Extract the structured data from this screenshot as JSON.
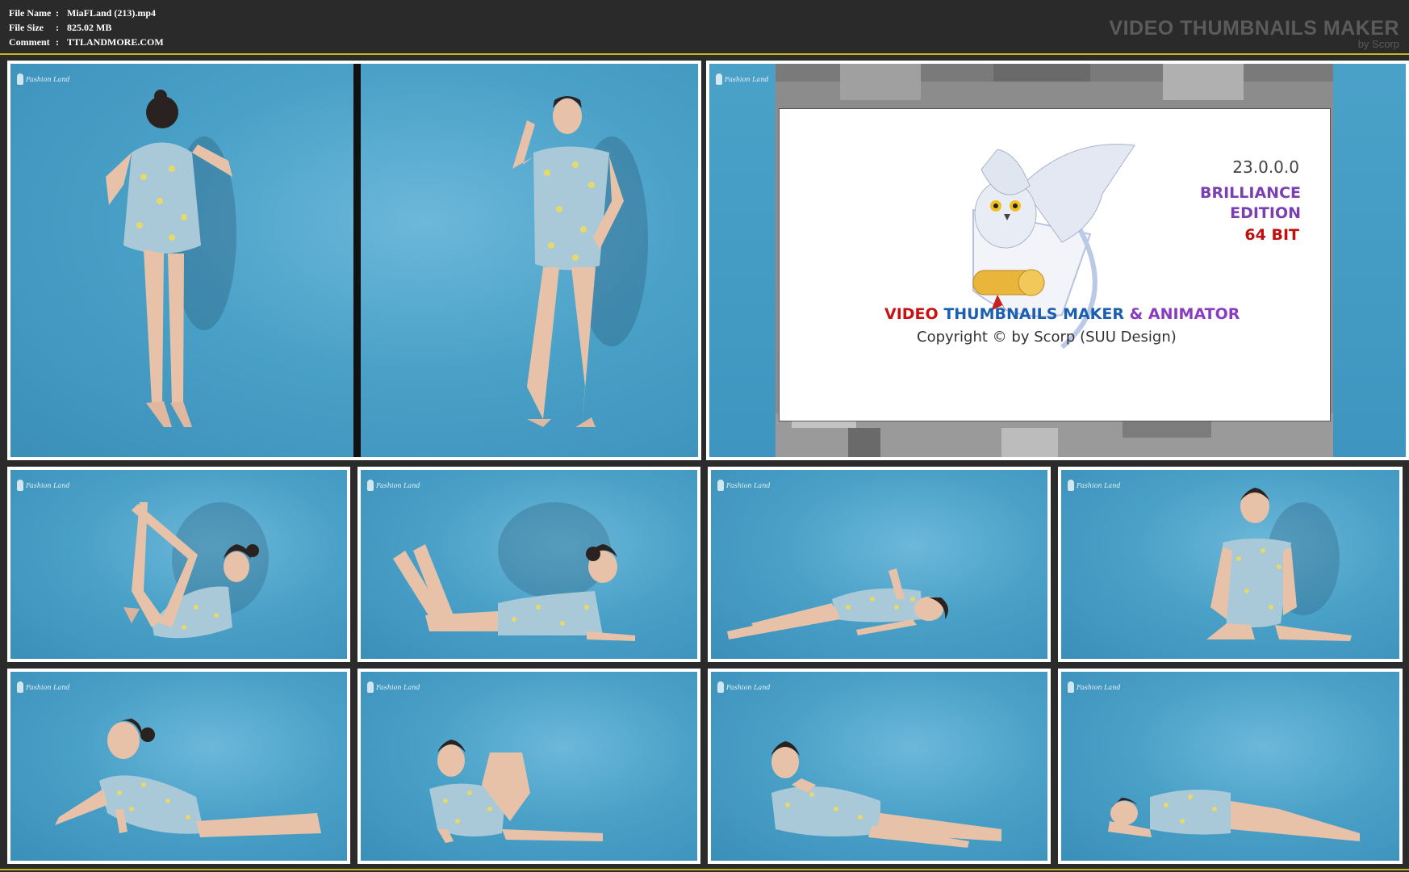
{
  "header": {
    "file_name_label": "File Name",
    "file_name_value": "MiaFLand (213).mp4",
    "file_size_label": "File Size",
    "file_size_value": "825.02 MB",
    "comment_label": "Comment",
    "comment_value": "TTLANDMORE.COM",
    "separator": ":",
    "brand_title": "VIDEO THUMBNAILS MAKER",
    "brand_sub": "by Scorp"
  },
  "watermark": "Fashion Land",
  "splash": {
    "version": "23.0.0.0",
    "edition_line1": "BRILLIANCE",
    "edition_line2": "EDITION",
    "bits": "64 BIT",
    "title_video": "VIDEO",
    "title_thumbnails": "THUMBNAILS MAKER",
    "title_amp": "&",
    "title_animator": "ANIMATOR",
    "copyright": "Copyright © by Scorp (SUU Design)"
  },
  "colors": {
    "background": "#2b2b2b",
    "accent_line": "#c7b521",
    "backdrop_blue": "#4aa1c8",
    "frame": "#ffffff"
  }
}
